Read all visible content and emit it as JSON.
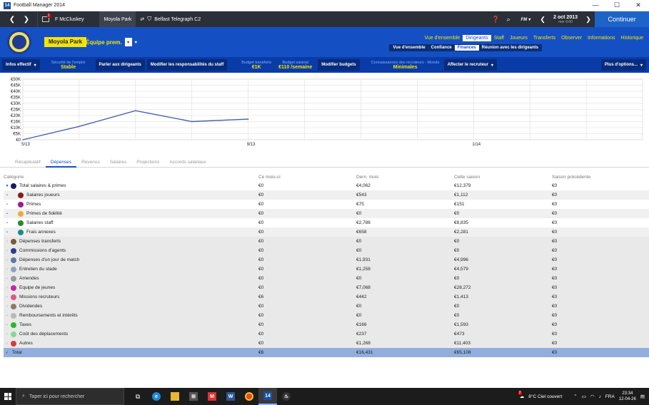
{
  "window": {
    "title": "Football Manager 2014",
    "icon_label": "14"
  },
  "topbar": {
    "manager": "F McCluskey",
    "message_badge": "1",
    "club": "Moyola Park",
    "next_match": "Belfast Telegraph C2",
    "fm_label": "FM",
    "date": "2 oct 2013",
    "day": "mer 6:00",
    "continue_label": "Continuer"
  },
  "header": {
    "club_name": "Moyola Park",
    "team_select": "Équipe prem.",
    "nav": [
      "Vue d'ensemble",
      "Dirigeants",
      "Staff",
      "Joueurs",
      "Transferts",
      "Observer",
      "Informations",
      "Historique"
    ],
    "subnav": [
      "Vue d'ensemble",
      "Confiance",
      "Finances",
      "Réunion avec les dirigeants"
    ]
  },
  "toolbar": {
    "infos_label": "Infos effectif",
    "job_security_label": "Sécurité de l'emploi",
    "job_security_value": "Stable",
    "talk_board": "Parler aux dirigeants",
    "modify_staff": "Modifier les responsabilités du staff",
    "transfer_budget_label": "Budget transferts",
    "transfer_budget_value": "€1K",
    "wage_budget_label": "Budget salarial",
    "wage_budget_value": "€110 /semaine",
    "modify_budgets": "Modifier budgets",
    "scout_knowledge_label": "Connaissances des recruteurs - Monde",
    "scout_knowledge_value": "Minimales",
    "assign_scout": "Affecter le recruteur",
    "more_options": "Plus d'options..."
  },
  "chart_data": {
    "type": "line",
    "y_ticks": [
      "€50K",
      "€45K",
      "€40K",
      "€35K",
      "€30K",
      "€26K",
      "€20K",
      "€16K",
      "€10K",
      "€5K",
      "€0"
    ],
    "x_ticks": [
      "5/13",
      "9/13",
      "1/14"
    ],
    "ylim": [
      0,
      50000
    ],
    "series": [
      {
        "values": [
          0,
          11000,
          24000,
          15000,
          17000
        ]
      }
    ],
    "line_color": "#4a5fae"
  },
  "tabs": [
    "Récapitulatif",
    "Dépenses",
    "Revenus",
    "Salaires",
    "Projections",
    "Accords salariaux"
  ],
  "table": {
    "headers": [
      "Catégorie",
      "Ce mois-ci",
      "Dern. mois",
      "Cette saison",
      "Saison précédente"
    ],
    "rows": [
      {
        "label": "Total salaires & primes",
        "color": "#1a1a6a",
        "values": [
          "€0",
          "€4,062",
          "€12,379",
          "€0"
        ],
        "kind": "parent"
      },
      {
        "label": "Salaires joueurs",
        "color": "#8b1a1a",
        "values": [
          "€0",
          "€543",
          "€1,112",
          "€0"
        ],
        "kind": "child"
      },
      {
        "label": "Primes",
        "color": "#9a1d8e",
        "values": [
          "€0",
          "€75",
          "€151",
          "€0"
        ],
        "kind": "child"
      },
      {
        "label": "Primes de fidélité",
        "color": "#f2a83a",
        "values": [
          "€0",
          "€0",
          "€0",
          "€0"
        ],
        "kind": "child"
      },
      {
        "label": "Salaires staff",
        "color": "#2a8a2a",
        "values": [
          "€0",
          "€2,786",
          "€8,835",
          "€0"
        ],
        "kind": "child"
      },
      {
        "label": "Frais annexes",
        "color": "#1e8a8a",
        "values": [
          "€0",
          "€658",
          "€2,281",
          "€0"
        ],
        "kind": "child"
      },
      {
        "label": "Dépenses transferts",
        "color": "#7a5a3a",
        "values": [
          "€0",
          "€0",
          "€0",
          "€0"
        ],
        "kind": "row"
      },
      {
        "label": "Commissions d'agents",
        "color": "#2c3e8a",
        "values": [
          "€0",
          "€0",
          "€0",
          "€0"
        ],
        "kind": "row"
      },
      {
        "label": "Dépenses d'un jour de match",
        "color": "#5a7aa8",
        "values": [
          "€0",
          "€1,931",
          "€4,996",
          "€0"
        ],
        "kind": "row"
      },
      {
        "label": "Entretien du stade",
        "color": "#8aa8b8",
        "values": [
          "€0",
          "€1,258",
          "€4,579",
          "€0"
        ],
        "kind": "row"
      },
      {
        "label": "Amendes",
        "color": "#9a9a9a",
        "values": [
          "€0",
          "€0",
          "€0",
          "€0"
        ],
        "kind": "row"
      },
      {
        "label": "Equipe de jeunes",
        "color": "#c02aa8",
        "values": [
          "€0",
          "€7,068",
          "€28,272",
          "€0"
        ],
        "kind": "row"
      },
      {
        "label": "Missions recruteurs",
        "color": "#d85a8a",
        "values": [
          "€6",
          "€442",
          "€1,413",
          "€0"
        ],
        "kind": "row"
      },
      {
        "label": "Dividendes",
        "color": "#8a7a6a",
        "values": [
          "€0",
          "€0",
          "€0",
          "€0"
        ],
        "kind": "row"
      },
      {
        "label": "Remboursements et intérêts",
        "color": "#b8b8b8",
        "values": [
          "€0",
          "€0",
          "€0",
          "€0"
        ],
        "kind": "row"
      },
      {
        "label": "Taxes",
        "color": "#2ab82a",
        "values": [
          "€0",
          "€166",
          "€1,593",
          "€0"
        ],
        "kind": "row"
      },
      {
        "label": "Coût des déplacements",
        "color": "#8ad88a",
        "values": [
          "€0",
          "€237",
          "€473",
          "€0"
        ],
        "kind": "row"
      },
      {
        "label": "Autres",
        "color": "#d83a3a",
        "values": [
          "€0",
          "€1,268",
          "€11,403",
          "€0"
        ],
        "kind": "row"
      }
    ],
    "total": {
      "label": "Total",
      "values": [
        "€6",
        "€16,431",
        "€65,108",
        "€0"
      ]
    }
  },
  "taskbar": {
    "search_placeholder": "Taper ici pour rechercher",
    "weather": "8°C  Ciel couvert",
    "weather_badge": "2",
    "lang": "FRA",
    "time": "23:34",
    "date": "12-04-26"
  }
}
